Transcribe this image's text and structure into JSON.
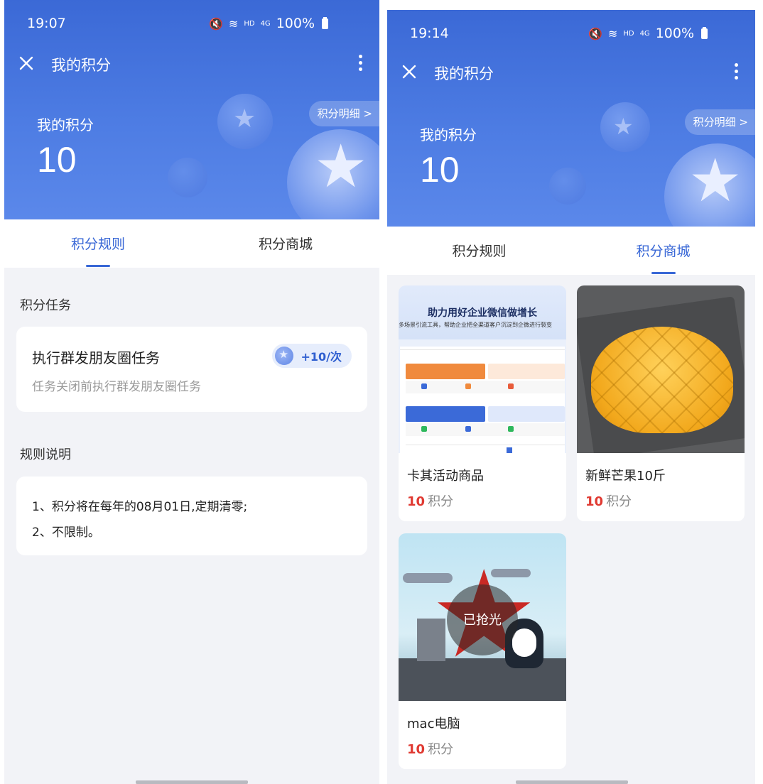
{
  "left": {
    "status": {
      "time": "19:07",
      "hd": "HD",
      "net": "4G",
      "battery": "100%"
    },
    "nav": {
      "title": "我的积分"
    },
    "header": {
      "detail_label": "积分明细 >",
      "points_label": "我的积分",
      "points_value": "10"
    },
    "tabs": [
      {
        "label": "积分规则",
        "active": true
      },
      {
        "label": "积分商城",
        "active": false
      }
    ],
    "task_section": {
      "title": "积分任务"
    },
    "task": {
      "title": "执行群发朋友圈任务",
      "desc": "任务关闭前执行群发朋友圈任务",
      "reward": "+10/次"
    },
    "rules_section": {
      "title": "规则说明"
    },
    "rules": [
      "1、积分将在每年的08月01日,定期清零;",
      "2、不限制。"
    ]
  },
  "right": {
    "status": {
      "time": "19:14",
      "hd": "HD",
      "net": "4G",
      "battery": "100%"
    },
    "nav": {
      "title": "我的积分"
    },
    "header": {
      "detail_label": "积分明细 >",
      "points_label": "我的积分",
      "points_value": "10"
    },
    "tabs": [
      {
        "label": "积分规则",
        "active": false
      },
      {
        "label": "积分商城",
        "active": true
      }
    ],
    "products": [
      {
        "name": "卡其活动商品",
        "points": "10",
        "unit": "积分",
        "banner_title": "助力用好企业微信做增长",
        "banner_sub": "多场景引流工具，帮助企业把全渠道客户沉淀到企微进行裂变"
      },
      {
        "name": "新鲜芒果10斤",
        "points": "10",
        "unit": "积分"
      },
      {
        "name": "mac电脑",
        "points": "10",
        "unit": "积分",
        "overlay": "已抢光"
      }
    ]
  },
  "colors": {
    "accent": "#3867d6",
    "price": "#e03a32",
    "header_top": "#3b69d6"
  }
}
